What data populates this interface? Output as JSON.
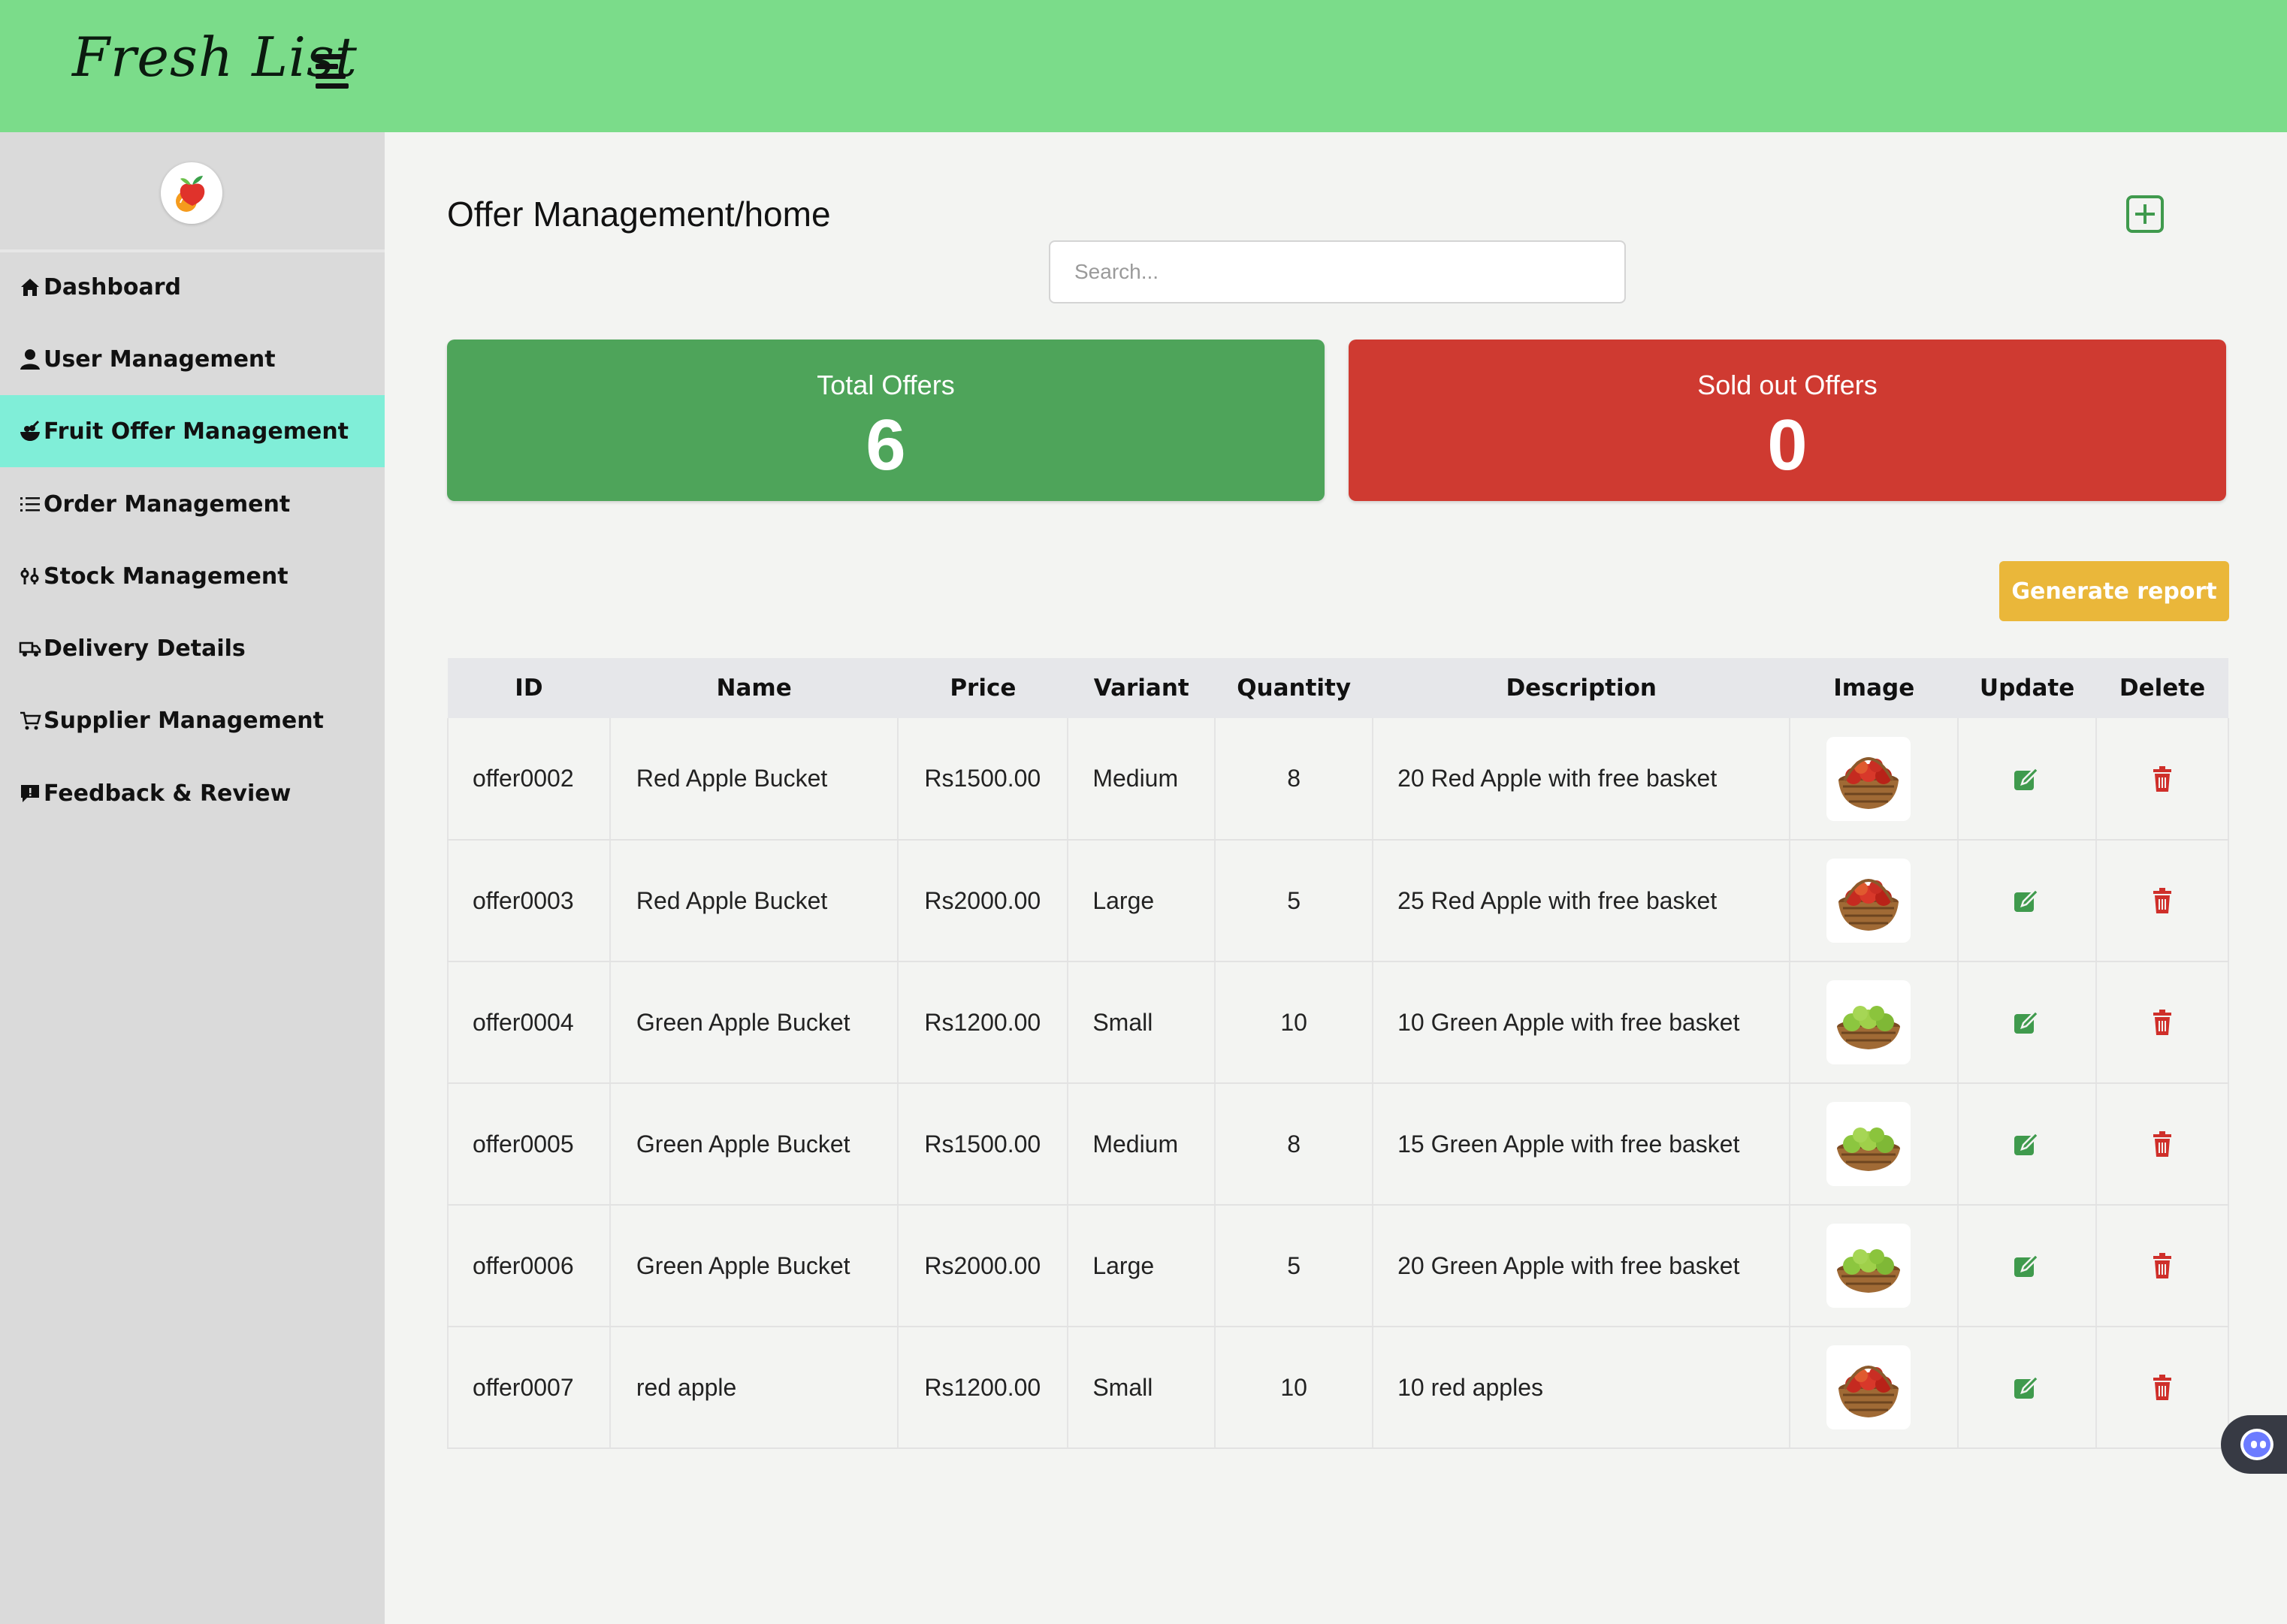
{
  "app": {
    "title": "Fresh List"
  },
  "sidebar": {
    "items": [
      {
        "label": "Dashboard",
        "icon": "home-icon",
        "active": false
      },
      {
        "label": "User Management",
        "icon": "user-icon",
        "active": false
      },
      {
        "label": "Fruit Offer Management",
        "icon": "fruit-bowl-icon",
        "active": true
      },
      {
        "label": "Order Management",
        "icon": "list-icon",
        "active": false
      },
      {
        "label": "Stock Management",
        "icon": "sliders-icon",
        "active": false
      },
      {
        "label": "Delivery Details",
        "icon": "truck-icon",
        "active": false
      },
      {
        "label": "Supplier Management",
        "icon": "cart-icon",
        "active": false
      },
      {
        "label": "Feedback & Review",
        "icon": "comment-icon",
        "active": false
      }
    ]
  },
  "main": {
    "title": "Offer Management/home",
    "search": {
      "placeholder": "Search..."
    },
    "stats": {
      "total": {
        "label": "Total Offers",
        "value": "6"
      },
      "sold": {
        "label": "Sold out Offers",
        "value": "0"
      }
    },
    "generate_label": "Generate report",
    "table": {
      "headers": [
        "ID",
        "Name",
        "Price",
        "Variant",
        "Quantity",
        "Description",
        "Image",
        "Update",
        "Delete"
      ],
      "rows": [
        {
          "id": "offer0002",
          "name": "Red Apple Bucket",
          "price": "Rs1500.00",
          "variant": "Medium",
          "quantity": "8",
          "description": "20 Red Apple with free basket",
          "image": "red-apple-basket"
        },
        {
          "id": "offer0003",
          "name": "Red Apple Bucket",
          "price": "Rs2000.00",
          "variant": "Large",
          "quantity": "5",
          "description": "25 Red Apple with free basket",
          "image": "red-apple-basket"
        },
        {
          "id": "offer0004",
          "name": "Green Apple Bucket",
          "price": "Rs1200.00",
          "variant": "Small",
          "quantity": "10",
          "description": "10 Green Apple with free basket",
          "image": "green-apple-basket"
        },
        {
          "id": "offer0005",
          "name": "Green Apple Bucket",
          "price": "Rs1500.00",
          "variant": "Medium",
          "quantity": "8",
          "description": "15 Green Apple with free basket",
          "image": "green-apple-basket"
        },
        {
          "id": "offer0006",
          "name": "Green Apple Bucket",
          "price": "Rs2000.00",
          "variant": "Large",
          "quantity": "5",
          "description": "20 Green Apple with free basket",
          "image": "green-apple-basket"
        },
        {
          "id": "offer0007",
          "name": "red apple",
          "price": "Rs1200.00",
          "variant": "Small",
          "quantity": "10",
          "description": "10 red apples",
          "image": "red-apple-basket"
        }
      ]
    }
  },
  "colors": {
    "topbar": "#7bdc8a",
    "sidebar": "#dadada",
    "active_nav": "#80eed8",
    "total_card": "#4ea45a",
    "sold_card": "#cf3a31",
    "generate_button": "#eab73a",
    "update_icon": "#3f9a4d",
    "delete_icon": "#cf2f2a"
  }
}
